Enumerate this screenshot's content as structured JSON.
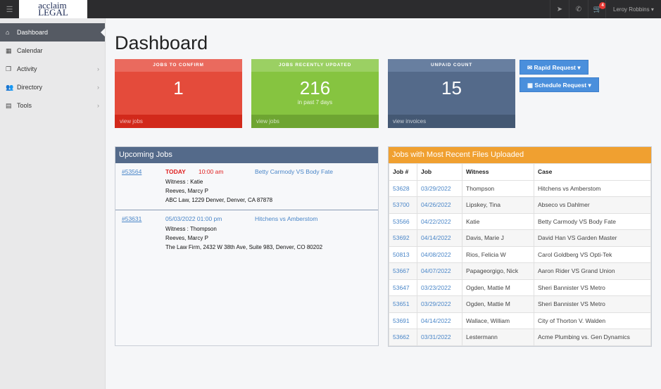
{
  "topbar": {
    "logo": "acclaim LEGAL",
    "user": "Leroy Robbins",
    "cart_count": "4",
    "icons": [
      "location-arrow-icon",
      "phone-icon",
      "cart-icon"
    ]
  },
  "sidebar": {
    "items": [
      {
        "label": "Dashboard",
        "icon": "home-icon",
        "active": true
      },
      {
        "label": "Calendar",
        "icon": "calendar-icon"
      },
      {
        "label": "Activity",
        "icon": "files-icon"
      },
      {
        "label": "Directory",
        "icon": "users-icon"
      },
      {
        "label": "Tools",
        "icon": "briefcase-icon"
      }
    ]
  },
  "page_title": "Dashboard",
  "cards": [
    {
      "title": "JOBS TO CONFIRM",
      "value": "1",
      "sub": "",
      "link": "view jobs",
      "color": "#e44b3b"
    },
    {
      "title": "JOBS RECENTLY UPDATED",
      "value": "216",
      "sub": "in past 7 days",
      "link": "view jobs",
      "color": "#86c440"
    },
    {
      "title": "UNPAID COUNT",
      "value": "15",
      "sub": "",
      "link": "view invoices",
      "color": "#546a8a"
    }
  ],
  "buttons": {
    "rapid": "Rapid Request",
    "schedule": "Schedule Request"
  },
  "upcoming": {
    "title": "Upcoming Jobs",
    "jobs": [
      {
        "id": "#53564",
        "date": "TODAY",
        "time": "10:00 am",
        "case": "Betty Carmody VS Body Fate",
        "witness": "Witness : Katie",
        "reporter": "Reeves, Marcy P",
        "location": "ABC Law, 1229 Denver, Denver, CA 87878"
      },
      {
        "id": "#53631",
        "date": "05/03/2022 01:00 pm",
        "time": "",
        "case": "Hitchens vs Amberstom",
        "witness": "Witness : Thompson",
        "reporter": "Reeves, Marcy P",
        "location": "The Law Firm, 2432 W 38th Ave, Suite 983, Denver, CO 80202"
      }
    ]
  },
  "recent": {
    "title": "Jobs with Most Recent Files Uploaded",
    "columns": [
      "Job #",
      "Job",
      "Witness",
      "Case"
    ],
    "rows": [
      [
        "53628",
        "03/29/2022",
        "Thompson",
        "Hitchens vs Amberstom"
      ],
      [
        "53700",
        "04/26/2022",
        "Lipskey, Tina",
        "Abseco vs Dahlmer"
      ],
      [
        "53566",
        "04/22/2022",
        "Katie",
        "Betty Carmody VS Body Fate"
      ],
      [
        "53692",
        "04/14/2022",
        "Davis, Marie J",
        "David Han VS Garden Master"
      ],
      [
        "50813",
        "04/08/2022",
        "Rios, Felicia W",
        "Carol Goldberg VS Opti-Tek"
      ],
      [
        "53667",
        "04/07/2022",
        "Papageorgigo, Nick",
        "Aaron Rider VS Grand Union"
      ],
      [
        "53647",
        "03/23/2022",
        "Ogden, Mattie M",
        "Sheri Bannister VS Metro"
      ],
      [
        "53651",
        "03/29/2022",
        "Ogden, Mattie M",
        "Sheri Bannister VS Metro"
      ],
      [
        "53691",
        "04/14/2022",
        "Wallace, William",
        "City of Thorton V. Walden"
      ],
      [
        "53662",
        "03/31/2022",
        "Lestermann",
        "Acme Plumbing vs. Gen Dynamics"
      ]
    ]
  }
}
